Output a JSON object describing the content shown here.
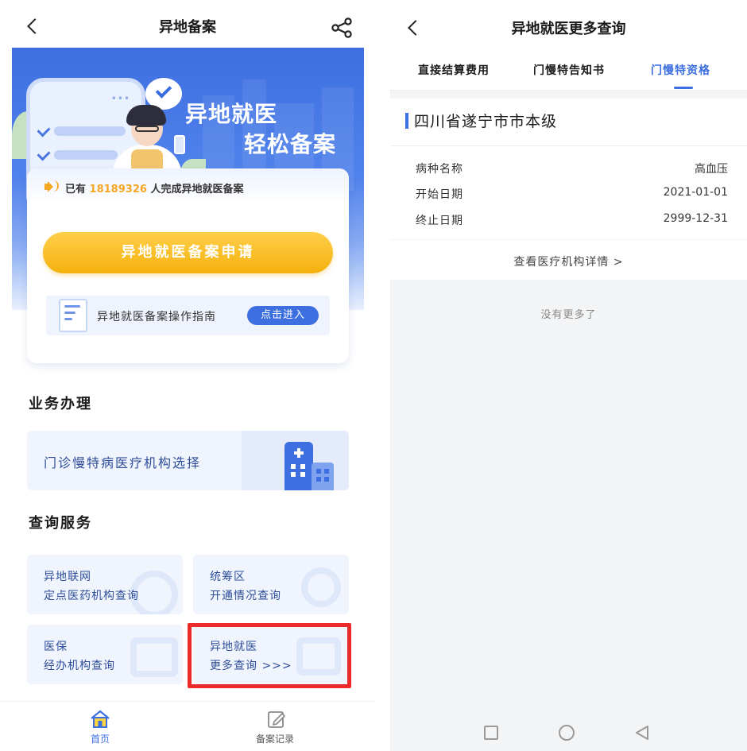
{
  "left": {
    "header": {
      "title": "异地备案"
    },
    "banner": {
      "line1": "异地就医",
      "line2": "轻松备案",
      "dots": "•••"
    },
    "notice": {
      "prefix": "已有",
      "count": "18189326",
      "suffix": "人完成异地就医备案"
    },
    "apply_button": "异地就医备案申请",
    "guide": {
      "label": "异地就医备案操作指南",
      "button": "点击进入"
    },
    "section_business": {
      "title": "业务办理",
      "items": [
        {
          "label": "门诊慢特病医疗机构选择"
        }
      ]
    },
    "section_query": {
      "title": "查询服务",
      "items": [
        {
          "line1": "异地联网",
          "line2": "定点医药机构查询"
        },
        {
          "line1": "统筹区",
          "line2": "开通情况查询"
        },
        {
          "line1": "医保",
          "line2": "经办机构查询"
        },
        {
          "line1": "异地就医",
          "line2": "更多查询 >>>"
        }
      ]
    },
    "tabbar": [
      {
        "label": "首页",
        "active": true
      },
      {
        "label": "备案记录",
        "active": false
      }
    ]
  },
  "right": {
    "header": {
      "title": "异地就医更多查询"
    },
    "tabs": [
      {
        "label": "直接结算费用",
        "active": false
      },
      {
        "label": "门慢特告知书",
        "active": false
      },
      {
        "label": "门慢特资格",
        "active": true
      }
    ],
    "card": {
      "region": "四川省遂宁市市本级",
      "rows": [
        {
          "label": "病种名称",
          "value": "高血压"
        },
        {
          "label": "开始日期",
          "value": "2021-01-01"
        },
        {
          "label": "终止日期",
          "value": "2999-12-31"
        }
      ]
    },
    "detail_link": "查看医疗机构详情 >",
    "no_more": "没有更多了"
  },
  "colors": {
    "accent": "#3d6fe0",
    "button_yellow": "#f4b10d",
    "count": "#f5a623",
    "highlight": "#ec2a2a"
  }
}
